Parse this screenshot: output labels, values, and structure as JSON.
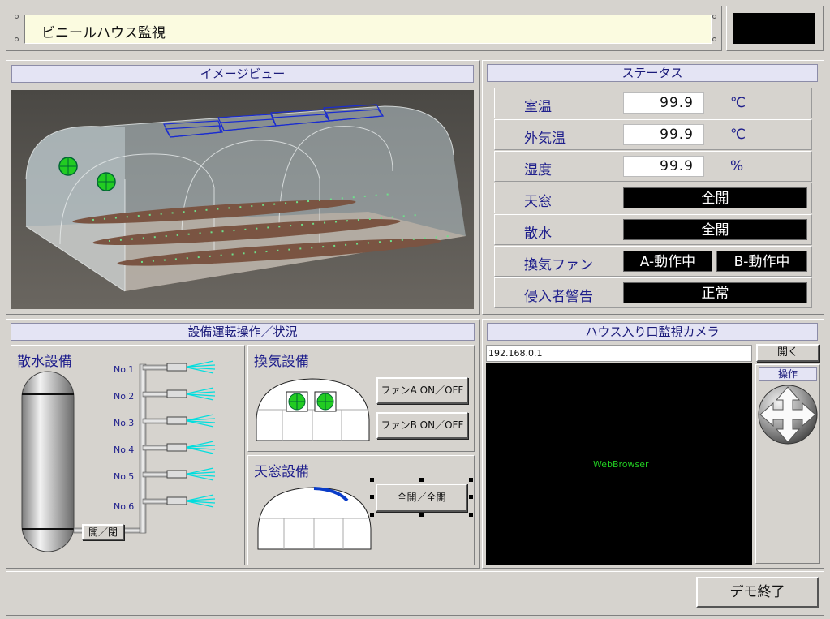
{
  "title": "ビニールハウス監視",
  "image_view": {
    "header": "イメージビュー"
  },
  "status": {
    "header": "ステータス",
    "rows": [
      {
        "label": "室温",
        "value": "99.9",
        "unit": "℃"
      },
      {
        "label": "外気温",
        "value": "99.9",
        "unit": "℃"
      },
      {
        "label": "湿度",
        "value": "99.9",
        "unit": "%"
      },
      {
        "label": "天窓",
        "value": "全開"
      },
      {
        "label": "散水",
        "value": "全開"
      },
      {
        "label": "換気ファン",
        "value_a": "A-動作中",
        "value_b": "B-動作中"
      },
      {
        "label": "侵入者警告",
        "value": "正常"
      }
    ]
  },
  "equipment": {
    "header": "設備運転操作／状況",
    "sprinkler": {
      "title": "散水設備",
      "nozzles": [
        "No.1",
        "No.2",
        "No.3",
        "No.4",
        "No.5",
        "No.6"
      ],
      "valve_button": "開／閉"
    },
    "ventilation": {
      "title": "換気設備",
      "fan_a_button": "ファンA ON／OFF",
      "fan_b_button": "ファンB ON／OFF"
    },
    "skylight": {
      "title": "天窓設備",
      "button": "全開／全開"
    }
  },
  "camera": {
    "header": "ハウス入り口監視カメラ",
    "address": "192.168.0.1",
    "open_button": "開く",
    "control_label": "操作",
    "browser_text": "WebBrowser"
  },
  "footer": {
    "end_button": "デモ終了"
  },
  "colors": {
    "label": "#1e1e8c",
    "header_bg": "#e4e4f4",
    "fan": "#22cc22",
    "skylight_arc": "#0a3cc8",
    "spray": "#00dede",
    "browser_text": "#22cc22"
  }
}
